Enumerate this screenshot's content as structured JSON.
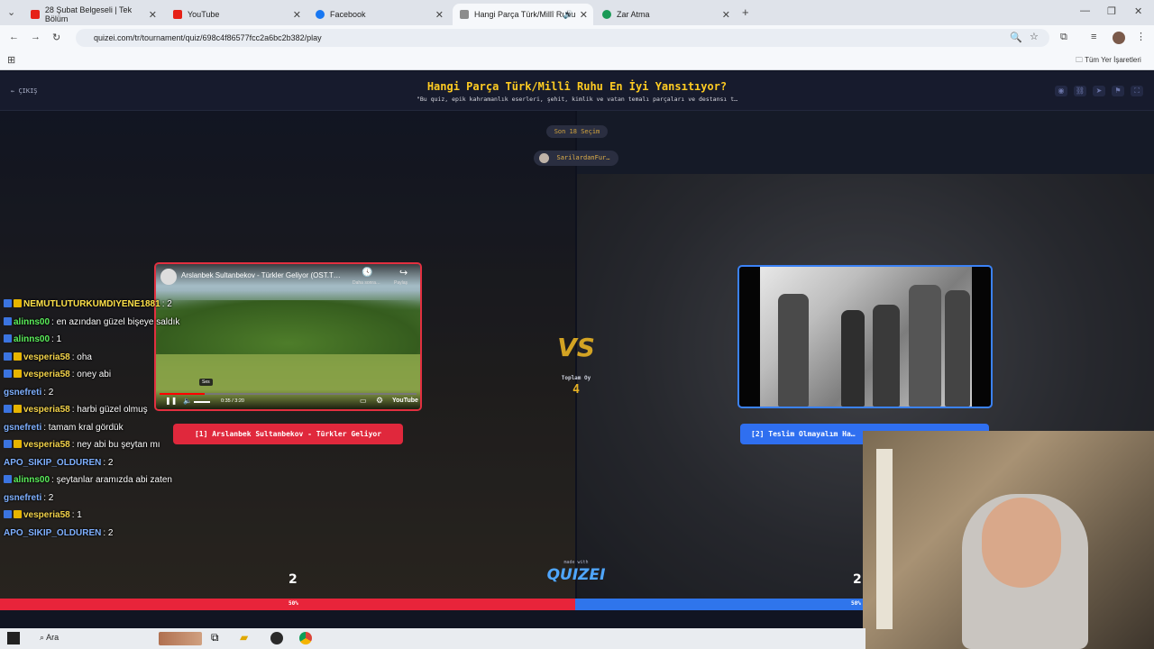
{
  "browser": {
    "tabs": [
      {
        "label": "28 Şubat Belgeseli | Tek Bölüm",
        "color": "#e62117"
      },
      {
        "label": "YouTube",
        "color": "#e62117"
      },
      {
        "label": "Facebook",
        "color": "#1877f2"
      },
      {
        "label": "Hangi Parça Türk/Millî Ruhu",
        "color": "#8c8c8c"
      },
      {
        "label": "Zar Atma",
        "color": "#1a9a56"
      }
    ],
    "new_tab": "+",
    "url": "quizei.com/tr/tournament/quiz/698c4f86577fcc2a6bc2b382/play",
    "bookmarks_label": "Tüm Yer İşaretleri"
  },
  "quiz": {
    "exit_label": "ÇIKIŞ",
    "title": "Hangi Parça Türk/Millî Ruhu En İyi Yansıtıyor?",
    "subtitle": "\"Bu quiz, epik kahramanlık eserleri, şehit, kimlik ve vatan temalı parçaları ve destansı t…",
    "round_label": "Son 18 Seçim",
    "creator": "SarilardanFur…",
    "vs_label": "VS",
    "total_votes_label": "Toplam Oy",
    "total_votes": "4",
    "made_with": "made with",
    "logo": "QUIZEI",
    "left": {
      "video_title": "Arslanbek Sultanbekov - Türkler Geliyor (OST.T…",
      "video_time": "0:35 / 3:20",
      "video_tooltip": "Ses",
      "video_more": "Daha sonra…",
      "video_share": "Paylaş",
      "video_brand": "YouTube",
      "button_label": "[1] Arslanbek Sultanbekov - Türkler Geliyor",
      "score": "2",
      "percent": "50%"
    },
    "right": {
      "button_label": "[2] Teslim Olmayalım Ha…",
      "score": "2",
      "percent": "50%"
    },
    "colors": {
      "left": "#e8243a",
      "right": "#2f75ec",
      "accent": "#ffcc22"
    }
  },
  "chat": [
    {
      "badges": [
        "blue",
        "yellow"
      ],
      "user": "NEMUTLUTURKUMDIYENE1881",
      "user_color": "#ffe24a",
      "text": ": 2"
    },
    {
      "badges": [
        "blue"
      ],
      "user": "alinns00",
      "user_color": "#5cf05c",
      "text": ": en azından güzel bişeye saldık"
    },
    {
      "badges": [
        "blue"
      ],
      "user": "alinns00",
      "user_color": "#5cf05c",
      "text": ": 1"
    },
    {
      "badges": [
        "blue",
        "yellow"
      ],
      "user": "vesperia58",
      "user_color": "#f2d24a",
      "text": ": oha"
    },
    {
      "badges": [
        "blue",
        "yellow"
      ],
      "user": "vesperia58",
      "user_color": "#f2d24a",
      "text": ": oney abi"
    },
    {
      "badges": [],
      "user": "gsnefreti",
      "user_color": "#7fb0ff",
      "text": ": 2"
    },
    {
      "badges": [
        "blue",
        "yellow"
      ],
      "user": "vesperia58",
      "user_color": "#f2d24a",
      "text": ": harbi güzel olmuş"
    },
    {
      "badges": [],
      "user": "gsnefreti",
      "user_color": "#7fb0ff",
      "text": ": tamam kral gördük"
    },
    {
      "badges": [
        "blue",
        "yellow"
      ],
      "user": "vesperia58",
      "user_color": "#f2d24a",
      "text": ": ney abi bu şeytan mı"
    },
    {
      "badges": [],
      "user": "APO_SIKIP_OLDUREN",
      "user_color": "#7fb0ff",
      "text": ": 2"
    },
    {
      "badges": [
        "blue"
      ],
      "user": "alinns00",
      "user_color": "#5cf05c",
      "text": ": şeytanlar aramızda abi zaten"
    },
    {
      "badges": [],
      "user": "gsnefreti",
      "user_color": "#7fb0ff",
      "text": ": 2"
    },
    {
      "badges": [
        "blue",
        "yellow"
      ],
      "user": "vesperia58",
      "user_color": "#f2d24a",
      "text": ": 1"
    },
    {
      "badges": [],
      "user": "APO_SIKIP_OLDUREN",
      "user_color": "#7fb0ff",
      "text": ": 2"
    }
  ],
  "taskbar": {
    "search_label": "Ara"
  }
}
